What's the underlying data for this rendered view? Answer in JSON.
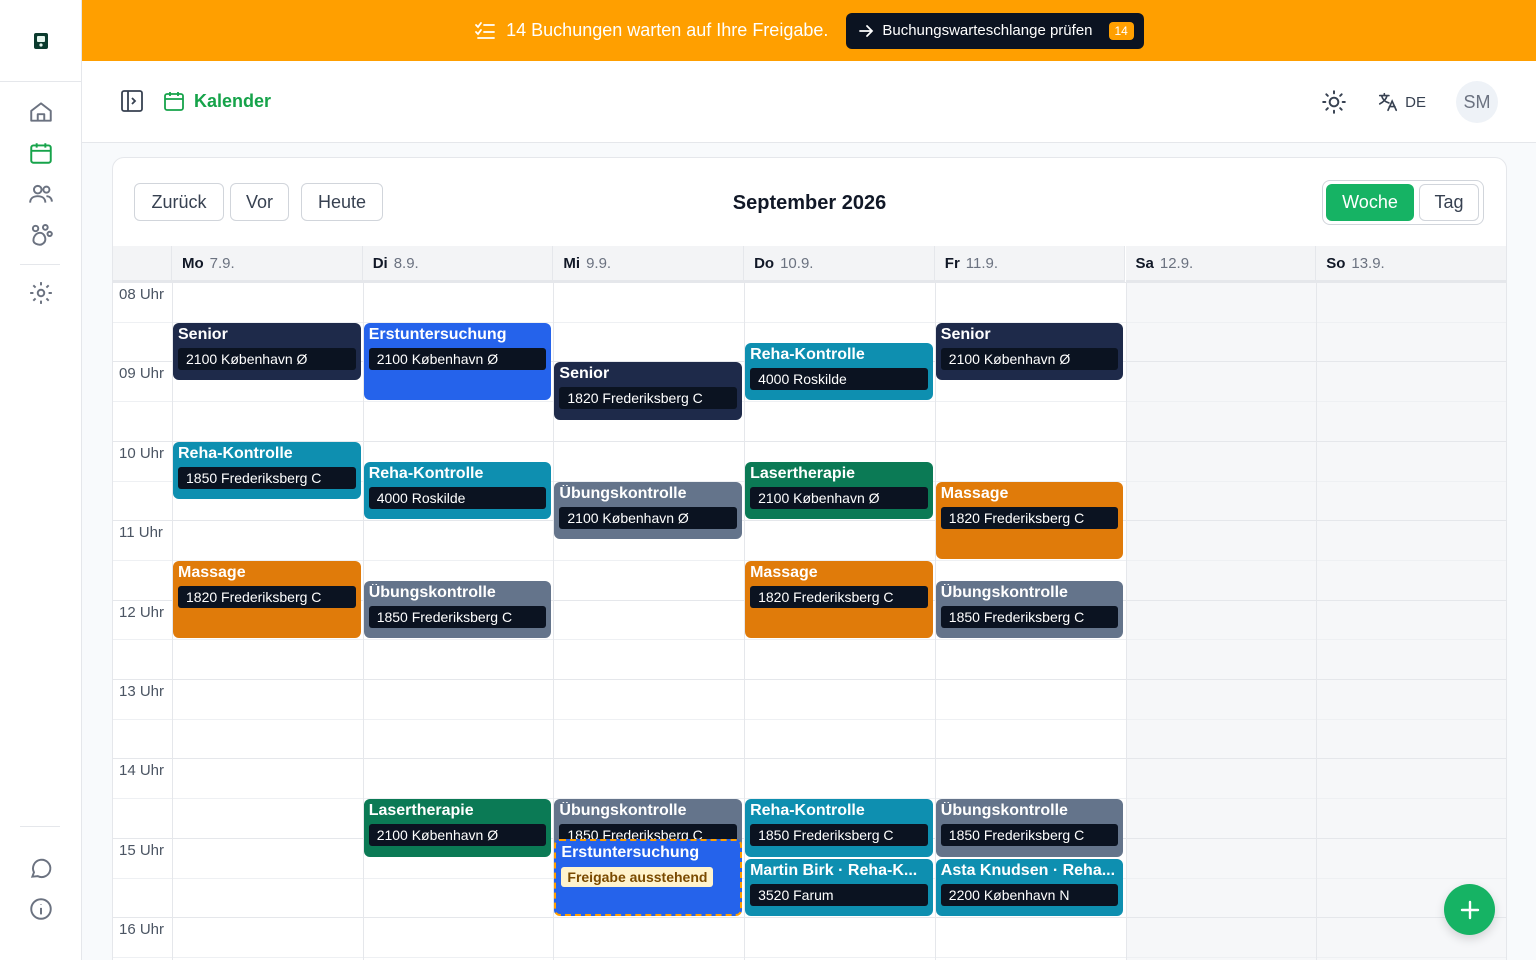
{
  "banner": {
    "message": "14 Buchungen warten auf Ihre Freigabe.",
    "button_label": "Buchungswarteschlange prüfen",
    "badge": "14"
  },
  "header": {
    "breadcrumb": "Kalender",
    "language": "DE",
    "avatar_initials": "SM"
  },
  "calendar": {
    "title": "September 2026",
    "nav": {
      "back": "Zurück",
      "next": "Vor",
      "today": "Heute"
    },
    "views": {
      "week": "Woche",
      "day": "Tag",
      "active": "week"
    },
    "days": [
      {
        "name": "Mo",
        "date": "7.9."
      },
      {
        "name": "Di",
        "date": "8.9."
      },
      {
        "name": "Mi",
        "date": "9.9."
      },
      {
        "name": "Do",
        "date": "10.9."
      },
      {
        "name": "Fr",
        "date": "11.9."
      },
      {
        "name": "Sa",
        "date": "12.9."
      },
      {
        "name": "So",
        "date": "13.9."
      }
    ],
    "hours": [
      "08 Uhr",
      "09 Uhr",
      "10 Uhr",
      "11 Uhr",
      "12 Uhr",
      "13 Uhr",
      "14 Uhr",
      "15 Uhr",
      "16 Uhr"
    ],
    "events": [
      {
        "day": 0,
        "start": "08:30",
        "end": "09:15",
        "title": "Senior",
        "location": "2100 København Ø",
        "color": "#1e2a4a"
      },
      {
        "day": 0,
        "start": "10:00",
        "end": "10:45",
        "title": "Reha-Kontrolle",
        "location": "1850 Frederiksberg C",
        "color": "#0e8fb0"
      },
      {
        "day": 0,
        "start": "11:30",
        "end": "12:30",
        "title": "Massage",
        "location": "1820 Frederiksberg C",
        "color": "#e07b0a"
      },
      {
        "day": 1,
        "start": "08:30",
        "end": "09:30",
        "title": "Erstuntersuchung",
        "location": "2100 København Ø",
        "color": "#2563eb"
      },
      {
        "day": 1,
        "start": "10:15",
        "end": "11:00",
        "title": "Reha-Kontrolle",
        "location": "4000 Roskilde",
        "color": "#0e8fb0"
      },
      {
        "day": 1,
        "start": "11:45",
        "end": "12:30",
        "title": "Übungskontrolle",
        "location": "1850 Frederiksberg C",
        "color": "#64748b"
      },
      {
        "day": 1,
        "start": "14:30",
        "end": "15:15",
        "title": "Lasertherapie",
        "location": "2100 København Ø",
        "color": "#0b7a55"
      },
      {
        "day": 2,
        "start": "09:00",
        "end": "09:45",
        "title": "Senior",
        "location": "1820 Frederiksberg C",
        "color": "#1e2a4a"
      },
      {
        "day": 2,
        "start": "10:30",
        "end": "11:15",
        "title": "Übungskontrolle",
        "location": "2100 København Ø",
        "color": "#64748b"
      },
      {
        "day": 2,
        "start": "14:30",
        "end": "15:15",
        "title": "Übungskontrolle",
        "location": "1850 Frederiksberg C",
        "color": "#64748b"
      },
      {
        "day": 2,
        "start": "15:00",
        "end": "16:00",
        "title": "Erstuntersuchung",
        "badge": "Freigabe ausstehend",
        "color": "#2563eb",
        "pending": true
      },
      {
        "day": 3,
        "start": "08:45",
        "end": "09:30",
        "title": "Reha-Kontrolle",
        "location": "4000 Roskilde",
        "color": "#0e8fb0"
      },
      {
        "day": 3,
        "start": "10:15",
        "end": "11:00",
        "title": "Lasertherapie",
        "location": "2100 København Ø",
        "color": "#0b7a55"
      },
      {
        "day": 3,
        "start": "11:30",
        "end": "12:30",
        "title": "Massage",
        "location": "1820 Frederiksberg C",
        "color": "#e07b0a"
      },
      {
        "day": 3,
        "start": "14:30",
        "end": "15:15",
        "title": "Reha-Kontrolle",
        "location": "1850 Frederiksberg C",
        "color": "#0e8fb0"
      },
      {
        "day": 3,
        "start": "15:15",
        "end": "16:00",
        "title": "Martin Birk · Reha-K...",
        "location": "3520 Farum",
        "color": "#0e8fb0"
      },
      {
        "day": 4,
        "start": "08:30",
        "end": "09:15",
        "title": "Senior",
        "location": "2100 København Ø",
        "color": "#1e2a4a"
      },
      {
        "day": 4,
        "start": "10:30",
        "end": "11:30",
        "title": "Massage",
        "location": "1820 Frederiksberg C",
        "color": "#e07b0a"
      },
      {
        "day": 4,
        "start": "11:45",
        "end": "12:30",
        "title": "Übungskontrolle",
        "location": "1850 Frederiksberg C",
        "color": "#64748b"
      },
      {
        "day": 4,
        "start": "14:30",
        "end": "15:15",
        "title": "Übungskontrolle",
        "location": "1850 Frederiksberg C",
        "color": "#64748b"
      },
      {
        "day": 4,
        "start": "15:15",
        "end": "16:00",
        "title": "Asta Knudsen · Reha...",
        "location": "2200 København N",
        "color": "#0e8fb0"
      }
    ]
  },
  "colors": {
    "banner": "#ff9f00",
    "accent_green": "#16b364",
    "active_nav": "#16a34a"
  },
  "icons": {
    "sidebar": [
      "logo-icon",
      "home-icon",
      "calendar-icon",
      "users-icon",
      "paw-icon",
      "settings-icon",
      "chat-icon",
      "info-icon"
    ],
    "header": [
      "sidebar-toggle-icon",
      "calendar-icon",
      "sun-icon",
      "translate-icon"
    ],
    "banner": [
      "checklist-icon",
      "arrow-right-icon"
    ],
    "fab": "plus-icon"
  }
}
